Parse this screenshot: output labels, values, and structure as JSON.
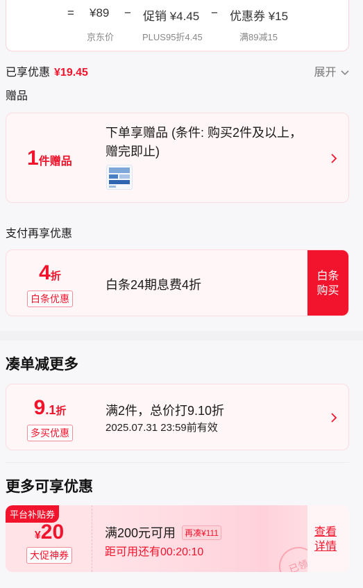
{
  "calc": {
    "eq": "=",
    "jd_price": "¥89",
    "minus1": "−",
    "promo_label": "促销 ¥4.45",
    "minus2": "−",
    "coupon_label": "优惠券 ¥15",
    "jd_price_caption": "京东价",
    "plus_caption": "PLUS95折4.45",
    "coupon_caption": "满89减15"
  },
  "enjoyed": {
    "label": "已享优惠",
    "amount": "¥19.45",
    "expand": "展开"
  },
  "gift": {
    "section": "赠品",
    "count": "1",
    "count_unit": "件赠品",
    "desc_line1": "下单享赠品 (条件: 购买2件及以上，",
    "desc_line2": "赠完即止)"
  },
  "pay": {
    "section": "支付再享优惠",
    "discount_num": "4",
    "discount_unit": "折",
    "tag": "白条优惠",
    "desc": "白条24期息费4折",
    "cta_line1": "白条",
    "cta_line2": "购买"
  },
  "bundle": {
    "title": "凑单减更多",
    "discount_num": "9",
    "discount_dec": ".1",
    "discount_unit": "折",
    "tag": "多买优惠",
    "desc": "满2件，总价打9.10折",
    "validity": "2025.07.31 23:59前有效"
  },
  "more": {
    "title": "更多可享优惠",
    "badge": "平台补贴券",
    "currency": "¥",
    "amount": "20",
    "tag": "大促神券",
    "desc": "满200元可用",
    "extra": "再凑¥111",
    "countdown": "距可用还有00:20:10",
    "cta_line1": "查看",
    "cta_line2": "详情",
    "stamp": "已领"
  },
  "colors": {
    "accent": "#f2142c",
    "card_bg": "#fff6f7",
    "border": "#fbdde1"
  },
  "icons": {
    "chevron": "chevron-right-icon",
    "expand": "chevron-down-icon"
  }
}
